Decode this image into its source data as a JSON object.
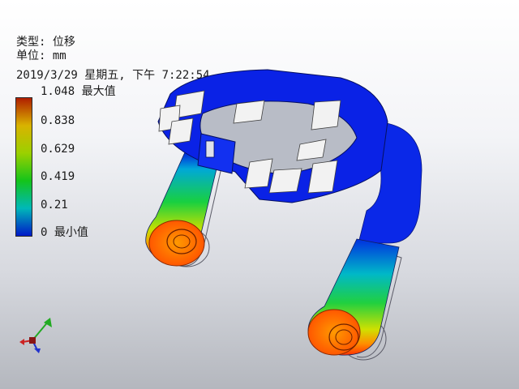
{
  "info": {
    "type_line": "类型: 位移",
    "unit_line": "单位: mm",
    "date_line": "2019/3/29 星期五, 下午 7:22:54"
  },
  "legend": {
    "labels": [
      "1.048 最大值",
      "0.838",
      "0.629",
      "0.419",
      "0.21",
      "0 最小值"
    ],
    "colors": [
      "#b01e00",
      "#d9b300",
      "#9bd000",
      "#14c41a",
      "#00b8b8",
      "#0019c8"
    ]
  },
  "triad": {
    "axes": [
      "x",
      "y",
      "z"
    ],
    "colors": {
      "x": "#cc2222",
      "y": "#22aa22",
      "z": "#2233cc"
    }
  }
}
